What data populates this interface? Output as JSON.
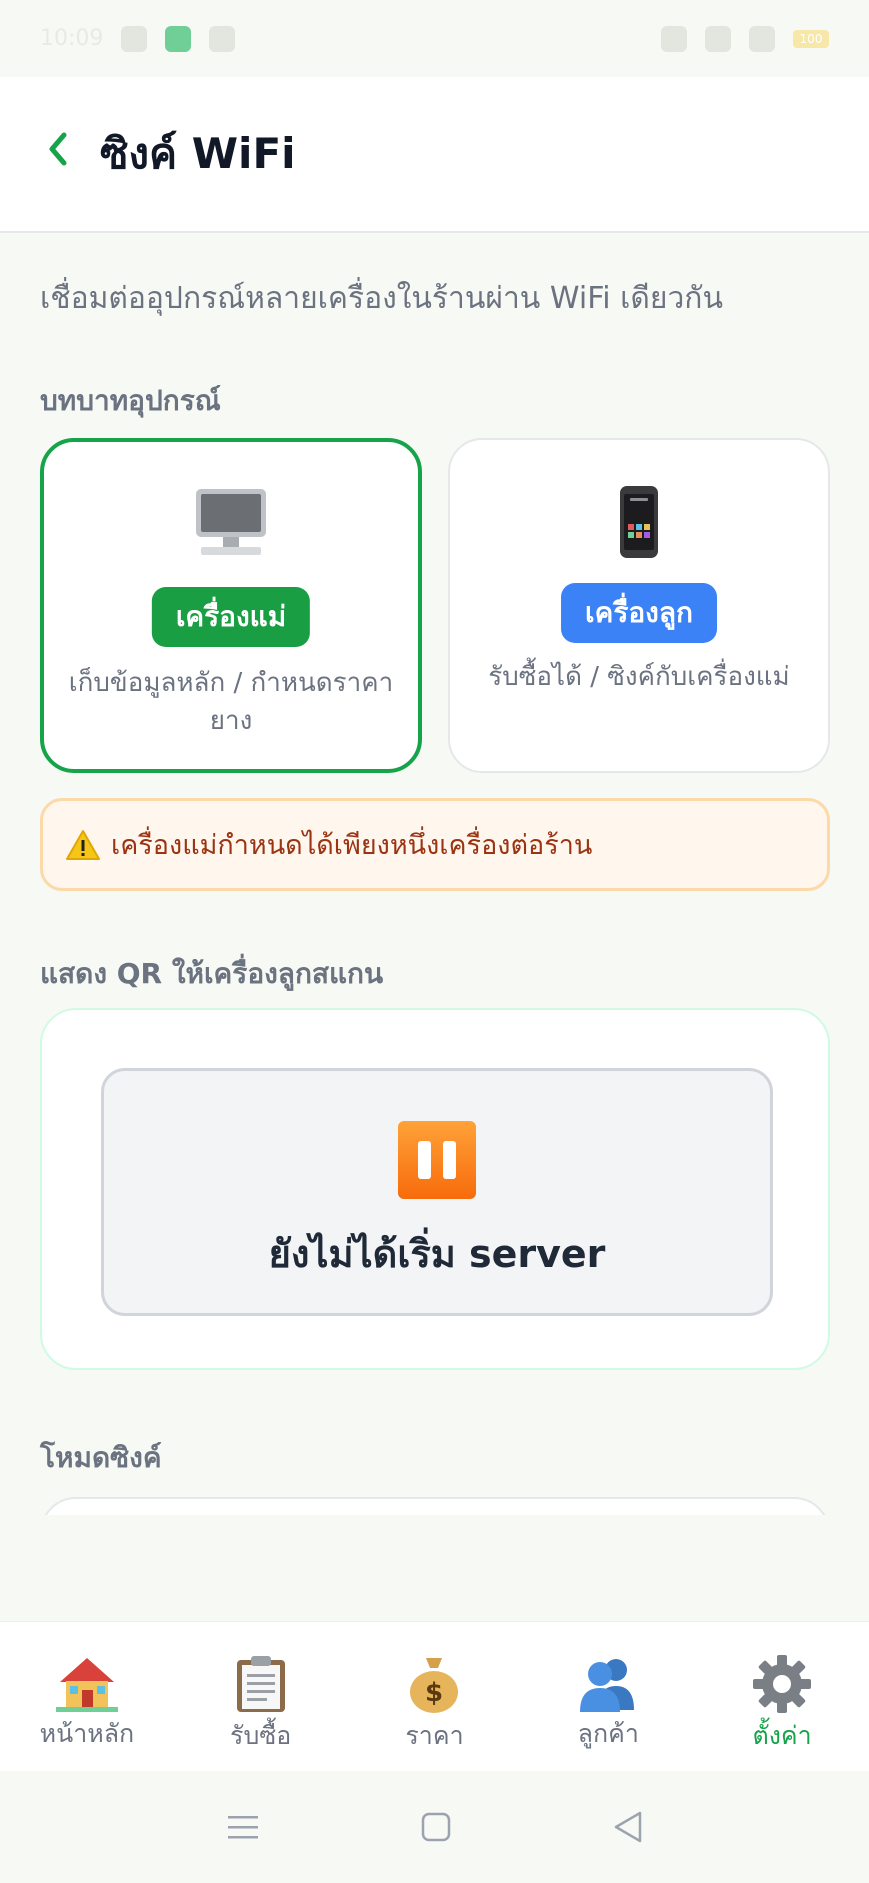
{
  "status_bar": {
    "time": "10:09",
    "battery": "100"
  },
  "header": {
    "back_icon": "chevron-left-icon",
    "title": "ซิงค์ WiFi"
  },
  "intro_text": "เชื่อมต่ออุปกรณ์หลายเครื่องในร้านผ่าน WiFi เดียวกัน",
  "roles_section": {
    "label": "บทบาทอุปกรณ์",
    "roles": [
      {
        "icon": "desktop-computer-icon",
        "badge": "เครื่องแม่",
        "badge_color": "#1a9e43",
        "description": "เก็บข้อมูลหลัก / กำหนดราคายาง",
        "selected": true
      },
      {
        "icon": "mobile-phone-icon",
        "badge": "เครื่องลูก",
        "badge_color": "#3b82f6",
        "description": "รับซื้อได้ / ซิงค์กับเครื่องแม่",
        "selected": false
      }
    ]
  },
  "warning": {
    "icon": "warning-icon",
    "text": "เครื่องแม่กำหนดได้เพียงหนึ่งเครื่องต่อร้าน"
  },
  "qr_section": {
    "label": "แสดง QR ให้เครื่องลูกสแกน",
    "status_icon": "pause-icon",
    "status_text": "ยังไม่ได้เริ่ม server"
  },
  "sync_mode_section": {
    "label": "โหมดซิงค์"
  },
  "bottom_nav": {
    "items": [
      {
        "icon": "house-icon",
        "label": "หน้าหลัก",
        "active": false
      },
      {
        "icon": "clipboard-icon",
        "label": "รับซื้อ",
        "active": false
      },
      {
        "icon": "money-bag-icon",
        "label": "ราคา",
        "active": false
      },
      {
        "icon": "people-icon",
        "label": "ลูกค้า",
        "active": false
      },
      {
        "icon": "gear-icon",
        "label": "ตั้งค่า",
        "active": true
      }
    ]
  },
  "colors": {
    "primary_green": "#16a34a",
    "accent_blue": "#3b82f6",
    "warning_bg": "#fff6ee",
    "warning_text": "#9a3412"
  }
}
